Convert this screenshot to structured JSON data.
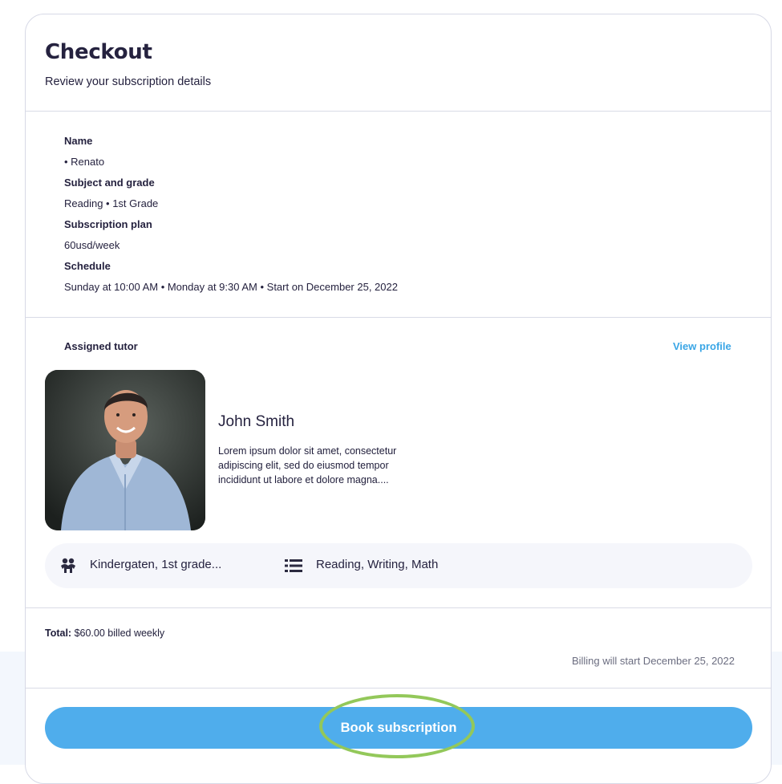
{
  "checkout": {
    "title": "Checkout",
    "subtitle": "Review your subscription details"
  },
  "details": {
    "name_label": "Name",
    "name_value": "• Renato",
    "subject_label": "Subject and grade",
    "subject_value": "Reading • 1st Grade",
    "plan_label": "Subscription plan",
    "plan_value": "60usd/week",
    "schedule_label": "Schedule",
    "schedule_value": "Sunday at 10:00 AM • Monday at 9:30 AM • Start on December 25, 2022"
  },
  "tutor": {
    "section_label": "Assigned tutor",
    "view_profile": "View profile",
    "name": "John Smith",
    "bio": "Lorem ipsum dolor sit amet, consectetur adipiscing elit, sed do eiusmod tempor incididunt ut labore et dolore magna....",
    "grades": "Kindergaten, 1st grade...",
    "subjects": "Reading, Writing, Math"
  },
  "summary": {
    "total_label": "Total:",
    "total_value": "$60.00 billed weekly",
    "billing_note": "Billing will start December 25, 2022"
  },
  "actions": {
    "book_label": "Book subscription"
  },
  "colors": {
    "accent": "#4fadec",
    "link": "#3aa6e6",
    "highlight": "#93c85a"
  },
  "icons": [
    "children-icon",
    "list-icon"
  ]
}
